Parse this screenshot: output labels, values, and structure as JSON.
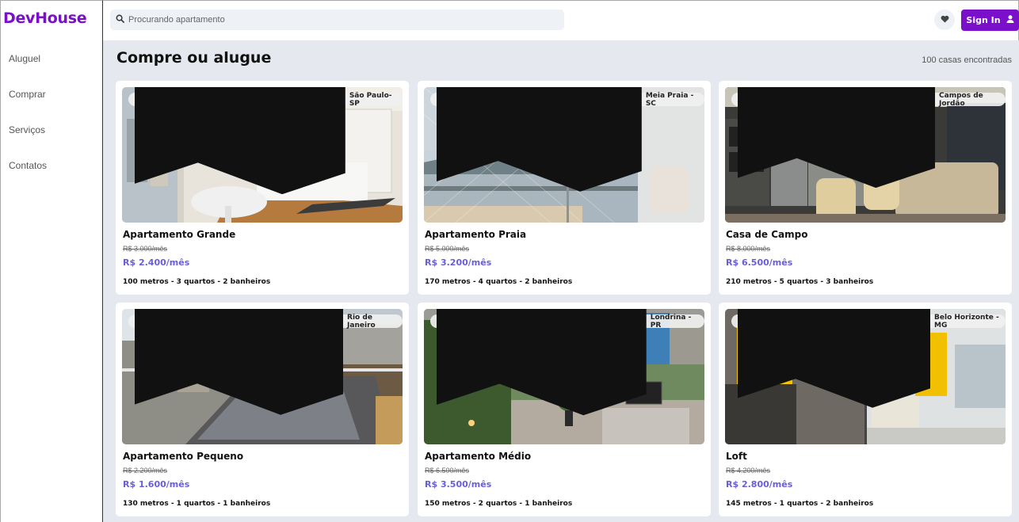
{
  "brand": "DevHouse",
  "sidebar": {
    "items": [
      {
        "label": "Aluguel"
      },
      {
        "label": "Comprar"
      },
      {
        "label": "Serviços"
      },
      {
        "label": "Contatos"
      }
    ]
  },
  "search": {
    "placeholder": "Procurando apartamento",
    "value": ""
  },
  "header": {
    "signin_label": "Sign In"
  },
  "main": {
    "title": "Compre ou alugue",
    "count": "100 casas encontradas"
  },
  "colors": {
    "brand": "#7a10c9",
    "price": "#6a5ed8",
    "background": "#e5e9ef"
  },
  "icons": {
    "search": "search-icon",
    "favorites": "heart-icon",
    "user": "user-icon",
    "location": "map-icon"
  },
  "listings": [
    {
      "location": "São Paulo-SP",
      "name": "Apartamento Grande",
      "old_price": "R$ 3.000/mês",
      "price": "R$ 2.400/mês",
      "specs": "100 metros - 3 quartos - 2 banheiros"
    },
    {
      "location": "Meia Praia - SC",
      "name": "Apartamento Praia",
      "old_price": "R$ 5.000/mês",
      "price": "R$ 3.200/mês",
      "specs": "170 metros - 4 quartos - 2 banheiros"
    },
    {
      "location": "Campos de Jordão",
      "name": "Casa de Campo",
      "old_price": "R$ 8.000/mês",
      "price": "R$ 6.500/mês",
      "specs": "210 metros - 5 quartos - 3 banheiros"
    },
    {
      "location": "Rio de Janeiro",
      "name": "Apartamento Pequeno",
      "old_price": "R$ 2.200/mês",
      "price": "R$ 1.600/mês",
      "specs": "130 metros - 1 quartos - 1 banheiros"
    },
    {
      "location": "Londrina - PR",
      "name": "Apartamento Médio",
      "old_price": "R$ 6.500/mês",
      "price": "R$ 3.500/mês",
      "specs": "150 metros - 2 quartos - 1 banheiros"
    },
    {
      "location": "Belo Horizonte - MG",
      "name": "Loft",
      "old_price": "R$ 4.200/mês",
      "price": "R$ 2.800/mês",
      "specs": "145 metros - 1 quartos - 2 banheiros"
    }
  ]
}
